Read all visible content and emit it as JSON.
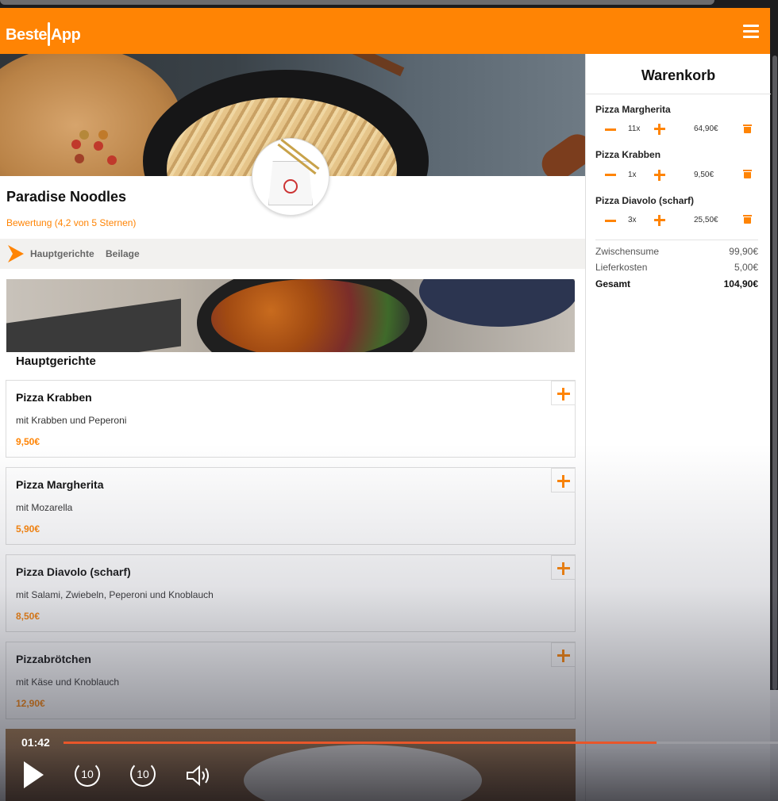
{
  "app": {
    "logo_text_a": "Beste",
    "logo_text_b": "App"
  },
  "restaurant": {
    "name": "Paradise Noodles",
    "rating": "Bewertung (4,2 von 5 Sternen)"
  },
  "categories": [
    "Hauptgerichte",
    "Beilage"
  ],
  "section": {
    "title": "Hauptgerichte"
  },
  "dishes": [
    {
      "name": "Pizza Krabben",
      "desc": "mit Krabben und Peperoni",
      "price": "9,50€"
    },
    {
      "name": "Pizza Margherita",
      "desc": "mit Mozarella",
      "price": "5,90€"
    },
    {
      "name": "Pizza Diavolo (scharf)",
      "desc": "mit Salami, Zwiebeln, Peperoni und Knoblauch",
      "price": "8,50€"
    },
    {
      "name": "Pizzabrötchen",
      "desc": "mit Käse und Knoblauch",
      "price": "12,90€"
    }
  ],
  "cart": {
    "title": "Warenkorb",
    "items": [
      {
        "name": "Pizza Margherita",
        "qty": "11x",
        "price": "64,90€"
      },
      {
        "name": "Pizza Krabben",
        "qty": "1x",
        "price": "9,50€"
      },
      {
        "name": "Pizza Diavolo (scharf)",
        "qty": "3x",
        "price": "25,50€"
      }
    ],
    "subtotal_label": "Zwischensume",
    "subtotal": "99,90€",
    "delivery_label": "Lieferkosten",
    "delivery": "5,00€",
    "total_label": "Gesamt",
    "total": "104,90€"
  },
  "player": {
    "time": "01:42",
    "progress": 0.83,
    "skip_back": "10",
    "skip_fwd": "10"
  },
  "colors": {
    "brand": "#ff8404",
    "progress": "#e8562a"
  },
  "icons": [
    "menu-icon",
    "minus-icon",
    "plus-icon",
    "trash-icon",
    "play-icon",
    "rewind-10-icon",
    "forward-10-icon",
    "volume-icon",
    "chevron-right-icon"
  ]
}
